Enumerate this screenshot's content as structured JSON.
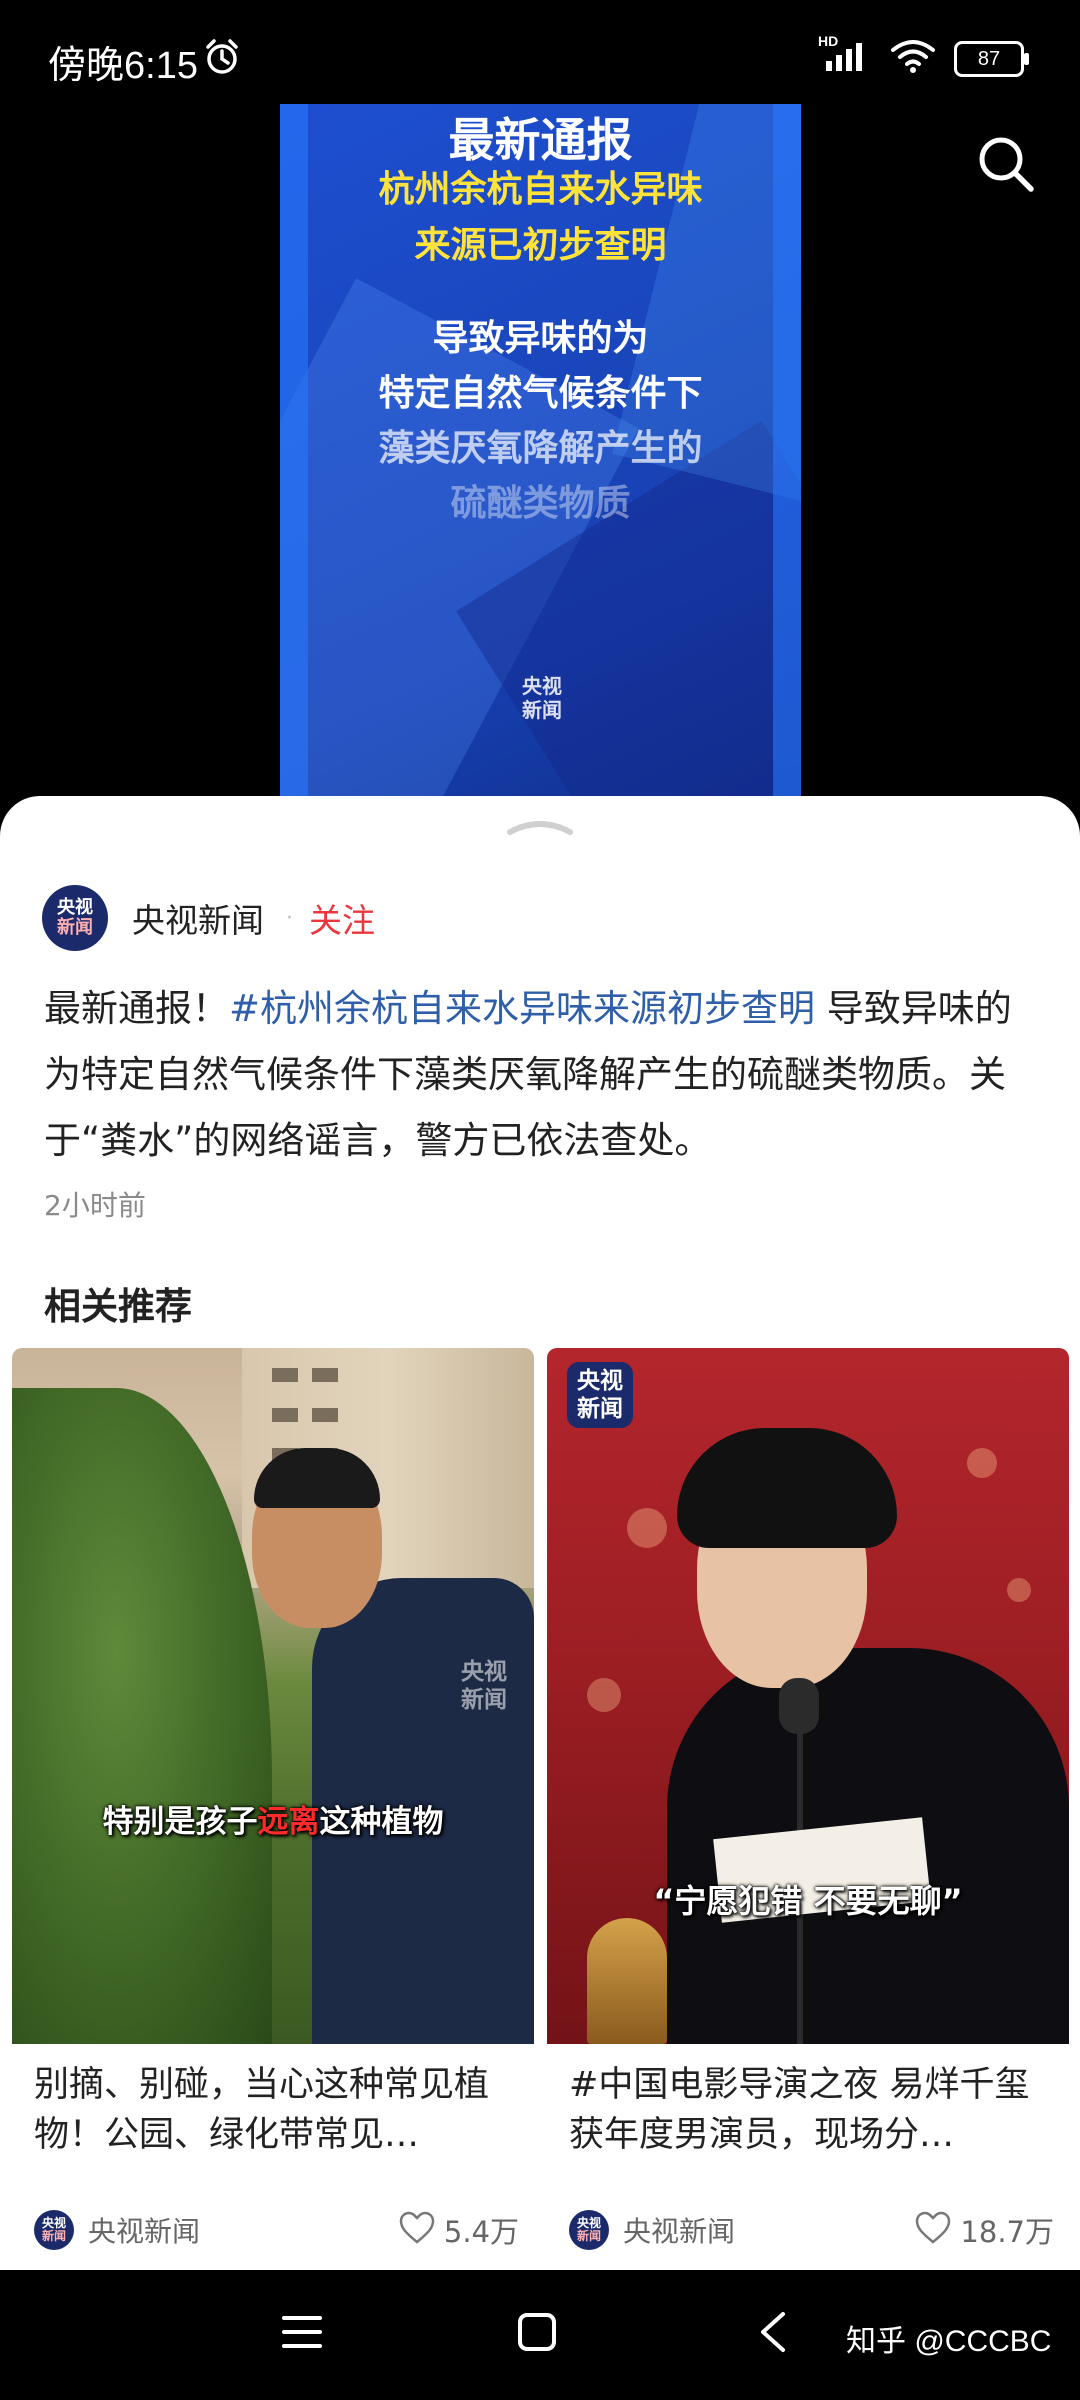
{
  "status_bar": {
    "time": "傍晚6:15",
    "network_label": "HD",
    "battery": "87"
  },
  "video": {
    "poster_title": "最新通报",
    "poster_subtitle_line1": "杭州余杭自来水异味",
    "poster_subtitle_line2": "来源已初步查明",
    "poster_body_line1": "导致异味的为",
    "poster_body_line2": "特定自然气候条件下",
    "poster_body_line3": "藻类厌氧降解产生的",
    "poster_body_line4": "硫醚类物质",
    "poster_logo_line1": "央视",
    "poster_logo_line2": "新闻"
  },
  "post": {
    "author_avatar_line1": "央视",
    "author_avatar_line2": "新闻",
    "author_name": "央视新闻",
    "separator": "·",
    "follow_label": "关注",
    "text_prefix": "最新通报！",
    "hashtag": "#杭州余杭自来水异味来源初步查明",
    "text_body": " 导致异味的为特定自然气候条件下藻类厌氧降解产生的硫醚类物质。关于“粪水”的网络谣言，警方已依法查处。",
    "time_ago": "2小时前"
  },
  "related": {
    "section_title": "相关推荐",
    "cards": [
      {
        "caption_before": "特别是孩子",
        "caption_highlight": "远离",
        "caption_after": "这种植物",
        "logo_line1": "央视",
        "logo_line2": "新闻",
        "title": "别摘、别碰，当心这种常见植物！公园、绿化带常见…",
        "author": "央视新闻",
        "likes": "5.4万"
      },
      {
        "caption": "“宁愿犯错 不要无聊”",
        "logo_line1": "央视",
        "logo_line2": "新闻",
        "title": "#中国电影导演之夜  易烊千玺获年度男演员，现场分…",
        "author": "央视新闻",
        "likes": "18.7万"
      }
    ]
  },
  "nav_bar": {
    "watermark": "知乎 @CCCBC"
  },
  "colors": {
    "follow": "#e8373e",
    "hashtag": "#2f5fa8",
    "poster_blue": "#1e4fd0",
    "poster_yellow": "#ffe33a",
    "caption_highlight": "#ff2a2a"
  }
}
